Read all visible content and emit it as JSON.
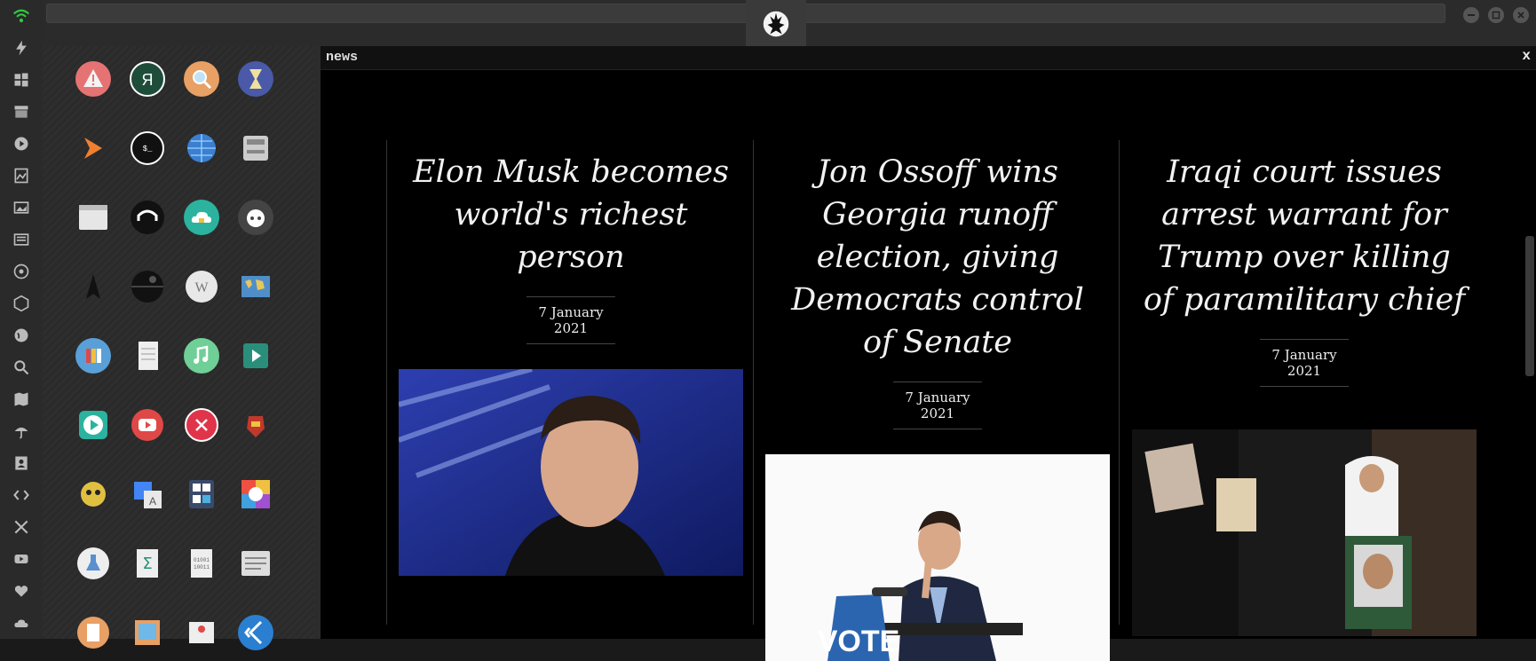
{
  "window": {
    "logo": "rebel-alliance-logo",
    "controls": [
      "minimize",
      "maximize",
      "close"
    ]
  },
  "dock": {
    "icons": [
      "wifi-icon",
      "bolt-icon",
      "windows-icon",
      "archive-icon",
      "play-icon",
      "photos-icon",
      "image-icon",
      "newspaper-icon",
      "galactic-empire-icon",
      "hexagon-icon",
      "globe-icon",
      "search-icon",
      "map-icon",
      "umbrella-icon",
      "contacts-icon",
      "code-icon",
      "expand-icon",
      "youtube-icon",
      "heart-icon",
      "cloud-icon"
    ]
  },
  "launcher": {
    "apps": [
      "warning-app-icon",
      "yandex-app-icon",
      "search-app-icon",
      "hourglass-app-icon",
      "sublime-app-icon",
      "terminal-app-icon",
      "globe-app-icon",
      "drive-app-icon",
      "window-app-icon",
      "headset-app-icon",
      "cloud-lock-app-icon",
      "github-app-icon",
      "starfleet-app-icon",
      "death-star-app-icon",
      "wikipedia-app-icon",
      "world-map-app-icon",
      "books-app-icon",
      "notes-app-icon",
      "music-app-icon",
      "video-app-icon",
      "play-app-icon",
      "youtube-app-icon",
      "close-app-icon",
      "iron-man-app-icon",
      "c3po-app-icon",
      "translate-app-icon",
      "calculator-app-icon",
      "color-picker-app-icon",
      "flask-app-icon",
      "sigma-app-icon",
      "binary-app-icon",
      "text-editor-app-icon",
      "document-app-icon",
      "image-viewer-app-icon",
      "presentation-app-icon",
      "vscode-app-icon"
    ]
  },
  "panel": {
    "title": "news",
    "close_label": "x",
    "articles": [
      {
        "headline": "Elon Musk becomes world's richest person",
        "date": "7 January 2021",
        "photo": "portrait of a man smiling against blue background"
      },
      {
        "headline": "Jon Ossoff wins Georgia runoff election, giving Democrats control of Senate",
        "date": "7 January 2021",
        "photo": "man speaking at VOTE podium"
      },
      {
        "headline": "Iraqi court issues arrest warrant for Trump over killing of paramilitary chief",
        "date": "7 January 2021",
        "photo": "crowd holding portraits"
      }
    ],
    "podium_text": "VOTE"
  }
}
